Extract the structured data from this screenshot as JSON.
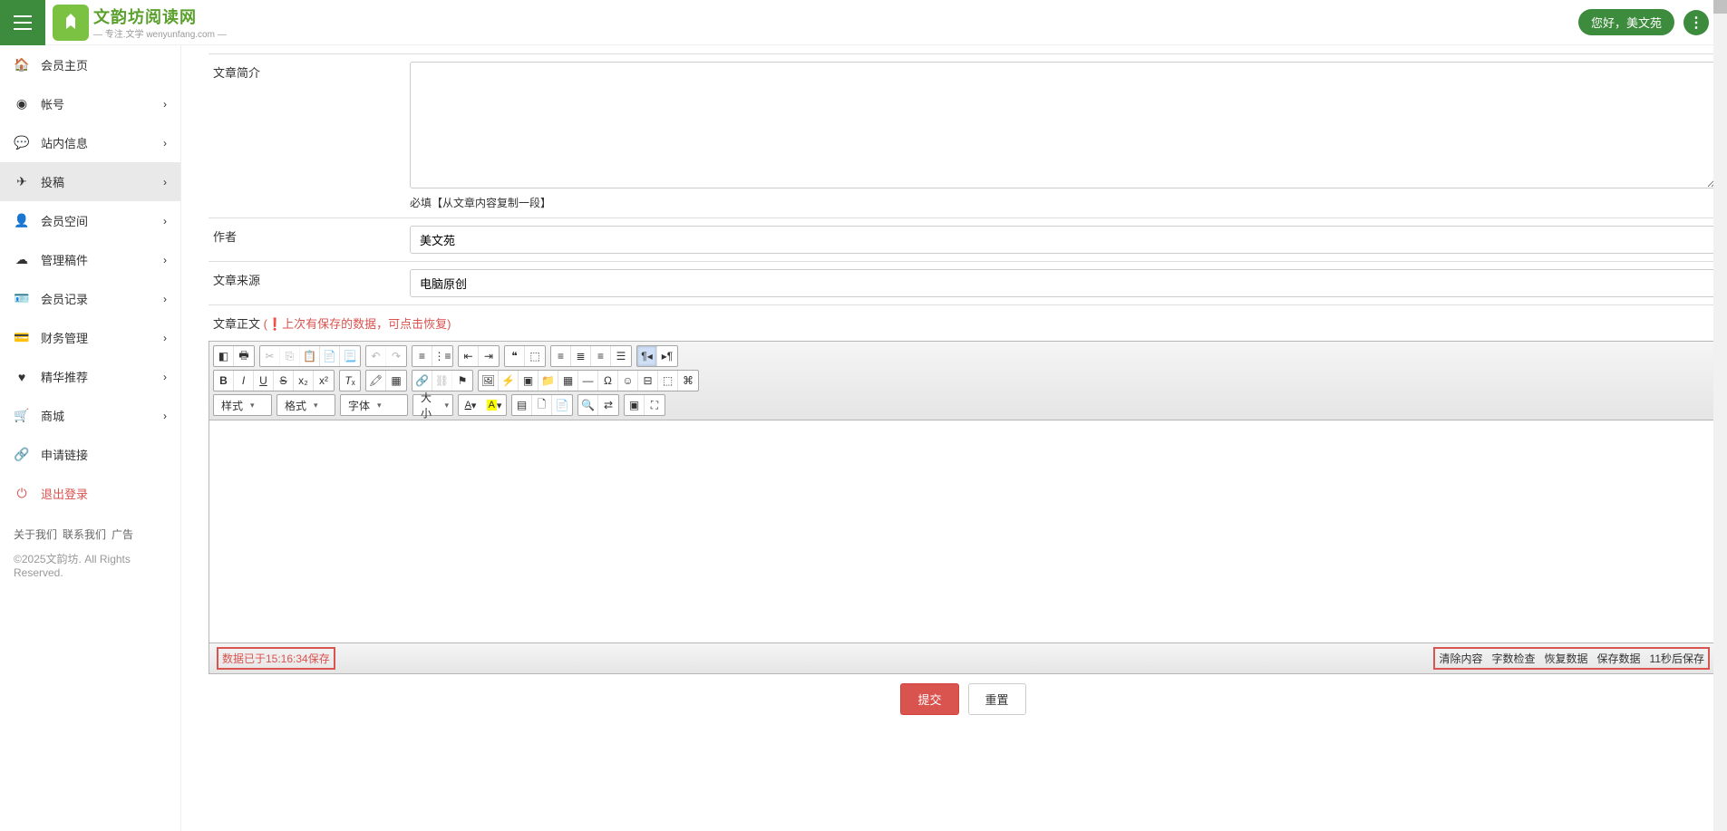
{
  "header": {
    "logo_text": "文韵坊阅读网",
    "logo_sub": "— 专注.文学 wenyunfang.com —",
    "user_greeting": "您好，美文苑",
    "more_glyph": "⋮"
  },
  "sidebar": {
    "items": [
      {
        "icon": "home",
        "label": "会员主页",
        "has_sub": false
      },
      {
        "icon": "user",
        "label": "帐号",
        "has_sub": true
      },
      {
        "icon": "comments",
        "label": "站内信息",
        "has_sub": true
      },
      {
        "icon": "send",
        "label": "投稿",
        "has_sub": true,
        "active": true
      },
      {
        "icon": "qq",
        "label": "会员空间",
        "has_sub": true
      },
      {
        "icon": "cloud",
        "label": "管理稿件",
        "has_sub": true
      },
      {
        "icon": "idcard",
        "label": "会员记录",
        "has_sub": true
      },
      {
        "icon": "card",
        "label": "财务管理",
        "has_sub": true
      },
      {
        "icon": "heart",
        "label": "精华推荐",
        "has_sub": true
      },
      {
        "icon": "cart",
        "label": "商城",
        "has_sub": true
      },
      {
        "icon": "link",
        "label": "申请链接",
        "has_sub": false
      },
      {
        "icon": "power",
        "label": "退出登录",
        "has_sub": false,
        "danger": true
      }
    ],
    "footer_links": [
      "关于我们",
      "联系我们",
      "广告"
    ],
    "copyright": "©2025文韵坊. All Rights Reserved."
  },
  "form": {
    "intro_label": "文章简介",
    "intro_value": "",
    "intro_hint": "必填【从文章内容复制一段】",
    "author_label": "作者",
    "author_value": "美文苑",
    "source_label": "文章来源",
    "source_value": "电脑原创",
    "body_label": "文章正文",
    "body_notice": "(❗上次有保存的数据，可点击恢复)"
  },
  "editor": {
    "selects": {
      "paragraph": "样式",
      "format": "格式",
      "font": "字体",
      "size": "大小"
    },
    "save_status": "数据已于15:16:34保存",
    "footer_actions": [
      "清除内容",
      "字数检查",
      "恢复数据",
      "保存数据",
      "11秒后保存"
    ]
  },
  "buttons": {
    "submit": "提交",
    "reset": "重置"
  }
}
